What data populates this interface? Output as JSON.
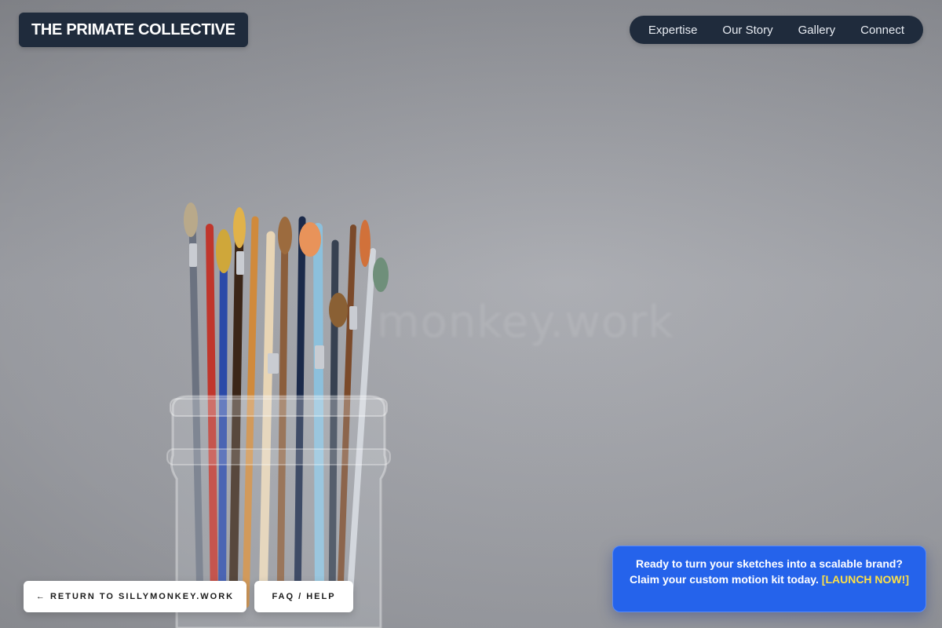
{
  "brand": {
    "logo_text": "THE PRIMATE COLLECTIVE"
  },
  "nav": {
    "items": [
      {
        "label": "Expertise"
      },
      {
        "label": "Our Story"
      },
      {
        "label": "Gallery"
      },
      {
        "label": "Connect"
      }
    ]
  },
  "hero": {
    "ghost_text": "monkey.work"
  },
  "footer": {
    "return_label": "← RETURN TO SILLYMONKEY.WORK",
    "faq_label": "FAQ / HELP"
  },
  "promo": {
    "line1": "Ready to turn your sketches into a scalable brand?",
    "line2": "Claim your custom motion kit today.",
    "cta": "[LAUNCH NOW!]"
  },
  "colors": {
    "dark_navy": "#1f2b3c",
    "promo_blue": "#2563eb",
    "cta_yellow": "#fde047",
    "button_white": "#ffffff"
  },
  "icons": {
    "return_arrow": "left-arrow-icon"
  }
}
